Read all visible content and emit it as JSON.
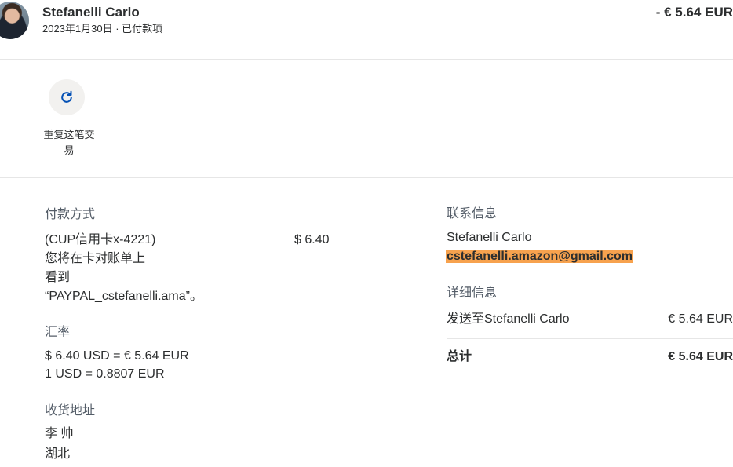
{
  "header": {
    "name": "Stefanelli Carlo",
    "date_status": "2023年1月30日 · 已付款项",
    "amount": "- € 5.64 EUR"
  },
  "actions": {
    "repeat_label": "重复这笔交易",
    "icon": "refresh-icon"
  },
  "payment": {
    "label": "付款方式",
    "method": "(CUP信用卡x-4221)",
    "amount": "$ 6.40",
    "note_lines": [
      "您将在卡对账单上",
      "看到",
      "“PAYPAL_cstefanelli.ama”。"
    ]
  },
  "exchange": {
    "label": "汇率",
    "lines": [
      "$ 6.40 USD = € 5.64 EUR",
      "1 USD = 0.8807 EUR"
    ]
  },
  "shipping": {
    "label": "收货地址",
    "lines": [
      "李 帅",
      "湖北"
    ]
  },
  "contact": {
    "label": "联系信息",
    "name": "Stefanelli Carlo",
    "email": "cstefanelli.amazon@gmail.com"
  },
  "details": {
    "label": "详细信息",
    "rows": [
      {
        "label": "发送至Stefanelli Carlo",
        "amount": "€ 5.64 EUR"
      }
    ],
    "total": {
      "label": "总计",
      "amount": "€ 5.64 EUR"
    }
  },
  "colors": {
    "accent": "#0551b5",
    "highlight": "#f7a24e",
    "text": "#2c2e2f",
    "muted": "#545d68",
    "divider": "#e6e6e6"
  }
}
